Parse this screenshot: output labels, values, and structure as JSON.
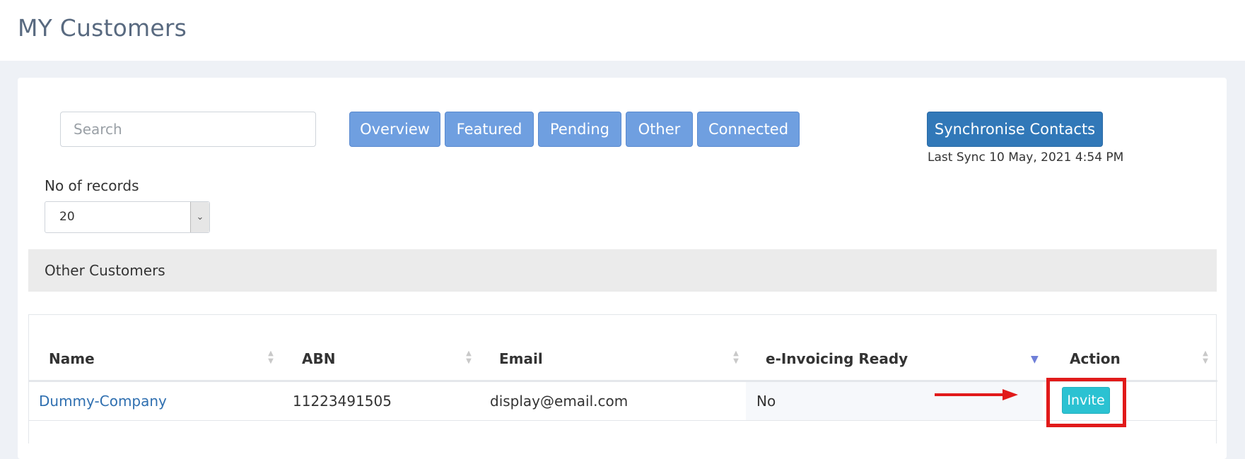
{
  "header": {
    "title": "MY Customers"
  },
  "search": {
    "placeholder": "Search",
    "value": ""
  },
  "tabs": [
    {
      "label": "Overview"
    },
    {
      "label": "Featured"
    },
    {
      "label": "Pending"
    },
    {
      "label": "Other"
    },
    {
      "label": "Connected"
    }
  ],
  "sync": {
    "button_label": "Synchronise Contacts",
    "last_sync": "Last Sync 10 May, 2021 4:54 PM"
  },
  "records": {
    "label": "No of records",
    "selected": "20"
  },
  "section": {
    "title": "Other Customers"
  },
  "table": {
    "columns": [
      "Name",
      "ABN",
      "Email",
      "e-Invoicing Ready",
      "Action"
    ],
    "rows": [
      {
        "name": "Dummy-Company",
        "abn": "11223491505",
        "email": "display@email.com",
        "einvoicing_ready": "No",
        "action_label": "Invite"
      }
    ]
  },
  "colors": {
    "tab_bg": "#6f9fe0",
    "sync_bg": "#3178b8",
    "invite_bg": "#2bc2d2",
    "link": "#2f6fb0",
    "annotation": "#e11a1a"
  }
}
